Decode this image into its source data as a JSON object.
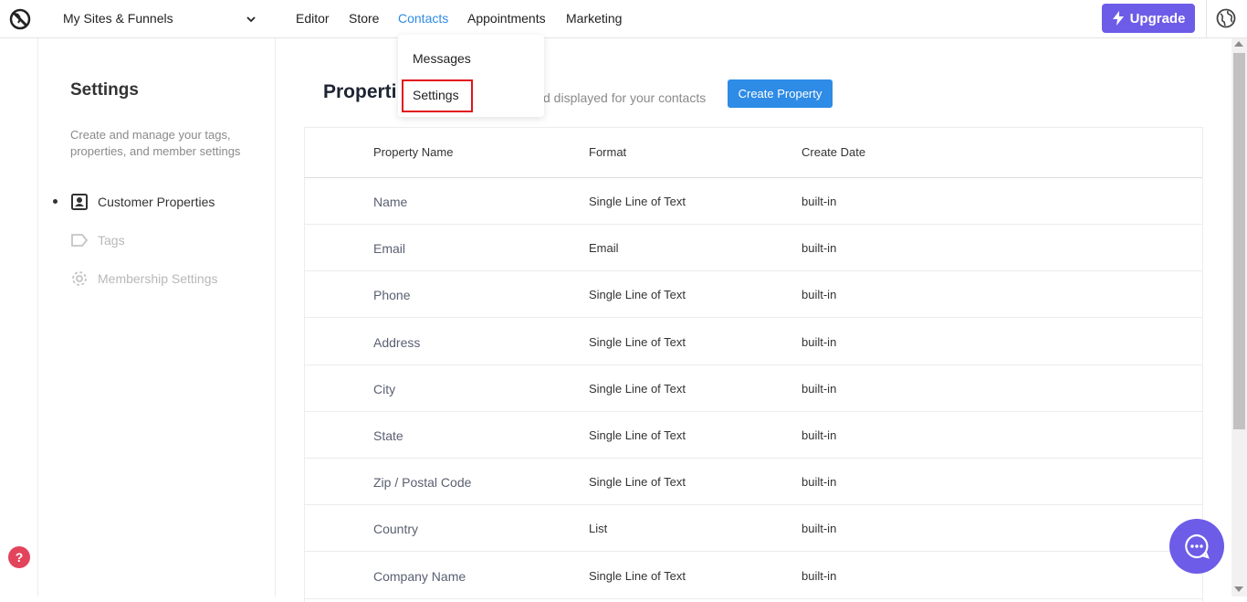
{
  "header": {
    "site_selector": "My Sites & Funnels",
    "nav": [
      {
        "label": "Editor"
      },
      {
        "label": "Store"
      },
      {
        "label": "Contacts"
      },
      {
        "label": "Appointments"
      },
      {
        "label": "Marketing"
      }
    ],
    "upgrade_label": "Upgrade"
  },
  "dropdown": {
    "items": [
      {
        "label": "Messages"
      },
      {
        "label": "Settings"
      }
    ]
  },
  "sidebar": {
    "title": "Settings",
    "description": "Create and manage your tags, properties, and member settings",
    "items": [
      {
        "label": "Customer Properties",
        "icon": "contact-card-icon",
        "active": true
      },
      {
        "label": "Tags",
        "icon": "tag-icon",
        "active": false
      },
      {
        "label": "Membership Settings",
        "icon": "gear-icon",
        "active": false
      }
    ]
  },
  "main": {
    "title": "Properti",
    "subtitle": "d displayed for your contacts",
    "create_button": "Create Property",
    "columns": [
      "Property Name",
      "Format",
      "Create Date"
    ],
    "rows": [
      {
        "name": "Name",
        "format": "Single Line of Text",
        "date": "built-in"
      },
      {
        "name": "Email",
        "format": "Email",
        "date": "built-in"
      },
      {
        "name": "Phone",
        "format": "Single Line of Text",
        "date": "built-in"
      },
      {
        "name": "Address",
        "format": "Single Line of Text",
        "date": "built-in"
      },
      {
        "name": "City",
        "format": "Single Line of Text",
        "date": "built-in"
      },
      {
        "name": "State",
        "format": "Single Line of Text",
        "date": "built-in"
      },
      {
        "name": "Zip / Postal Code",
        "format": "Single Line of Text",
        "date": "built-in"
      },
      {
        "name": "Country",
        "format": "List",
        "date": "built-in"
      },
      {
        "name": "Company Name",
        "format": "Single Line of Text",
        "date": "built-in"
      }
    ]
  },
  "help_label": "?",
  "colors": {
    "accent": "#2e8be6",
    "upgrade": "#6c5ce7",
    "highlight": "#e0141c",
    "help": "#e2445c"
  }
}
